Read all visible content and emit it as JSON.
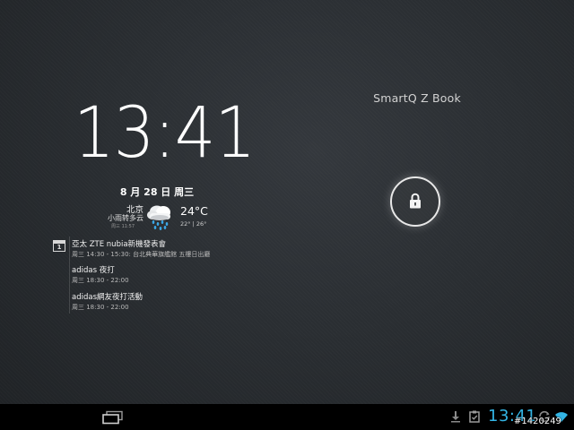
{
  "owner_info": "SmartQ Z Book",
  "clock": {
    "time": "13:41",
    "date": "8 月 28 日 周三"
  },
  "weather": {
    "city": "北京",
    "condition": "小雨转多云",
    "updated": "周三 11:57",
    "temperature": "24°C",
    "range": "22° | 26°",
    "icon": "rain-cloud-icon"
  },
  "calendar": {
    "icon_day": "1",
    "events": [
      {
        "title": "亞太 ZTE nubia新機發表會",
        "time": "周三 14:30 - 15:30: 台北典華旗艦館 五樓日出廳"
      },
      {
        "title": "adidas 夜打",
        "time": "周三 18:30 - 22:00"
      },
      {
        "title": "adidas網友夜打活動",
        "time": "周三 18:30 - 22:00"
      }
    ]
  },
  "lock": {
    "icon": "padlock-icon"
  },
  "navbar": {
    "recents_icon": "recent-apps-icon",
    "status_icons": [
      "download-icon",
      "clipboard-icon",
      "sync-icon",
      "wifi-icon"
    ],
    "clock": "13:41"
  },
  "watermark": "#1420249",
  "colors": {
    "accent": "#33b5e5",
    "background": "#2a2e32",
    "navbar": "#000000"
  }
}
